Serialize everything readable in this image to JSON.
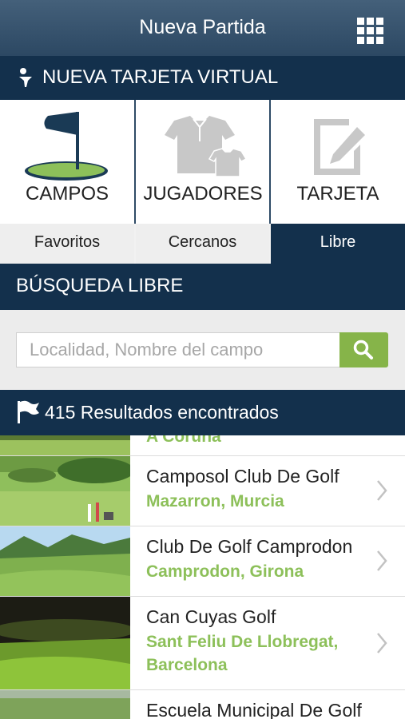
{
  "header": {
    "title": "Nueva Partida",
    "menu_icon": "grid-icon"
  },
  "new_card_bar": {
    "label": "NUEVA TARJETA VIRTUAL",
    "icon": "golf-tee-icon"
  },
  "cards": [
    {
      "label": "CAMPOS",
      "icon": "golf-flag-icon"
    },
    {
      "label": "JUGADORES",
      "icon": "polo-shirts-icon"
    },
    {
      "label": "TARJETA",
      "icon": "scorecard-edit-icon"
    }
  ],
  "tabs": [
    {
      "label": "Favoritos",
      "active": false
    },
    {
      "label": "Cercanos",
      "active": false
    },
    {
      "label": "Libre",
      "active": true
    }
  ],
  "search_section": {
    "title": "BÚSQUEDA LIBRE",
    "placeholder": "Localidad, Nombre del campo",
    "value": "",
    "button_icon": "search-icon"
  },
  "results_bar": {
    "label": "415 Resultados encontrados",
    "icon": "flag-icon"
  },
  "results": [
    {
      "name": "",
      "location": "A Coruña"
    },
    {
      "name": "Camposol Club De Golf",
      "location": "Mazarron, Murcia"
    },
    {
      "name": "Club De Golf Camprodon",
      "location": "Camprodon, Girona"
    },
    {
      "name": "Can Cuyas Golf",
      "location": "Sant Feliu De Llobregat, Barcelona"
    },
    {
      "name": "Escuela Municipal De Golf",
      "location": ""
    }
  ],
  "colors": {
    "navy": "#13304c",
    "accent_green": "#8dc05a",
    "button_green": "#86b449"
  }
}
